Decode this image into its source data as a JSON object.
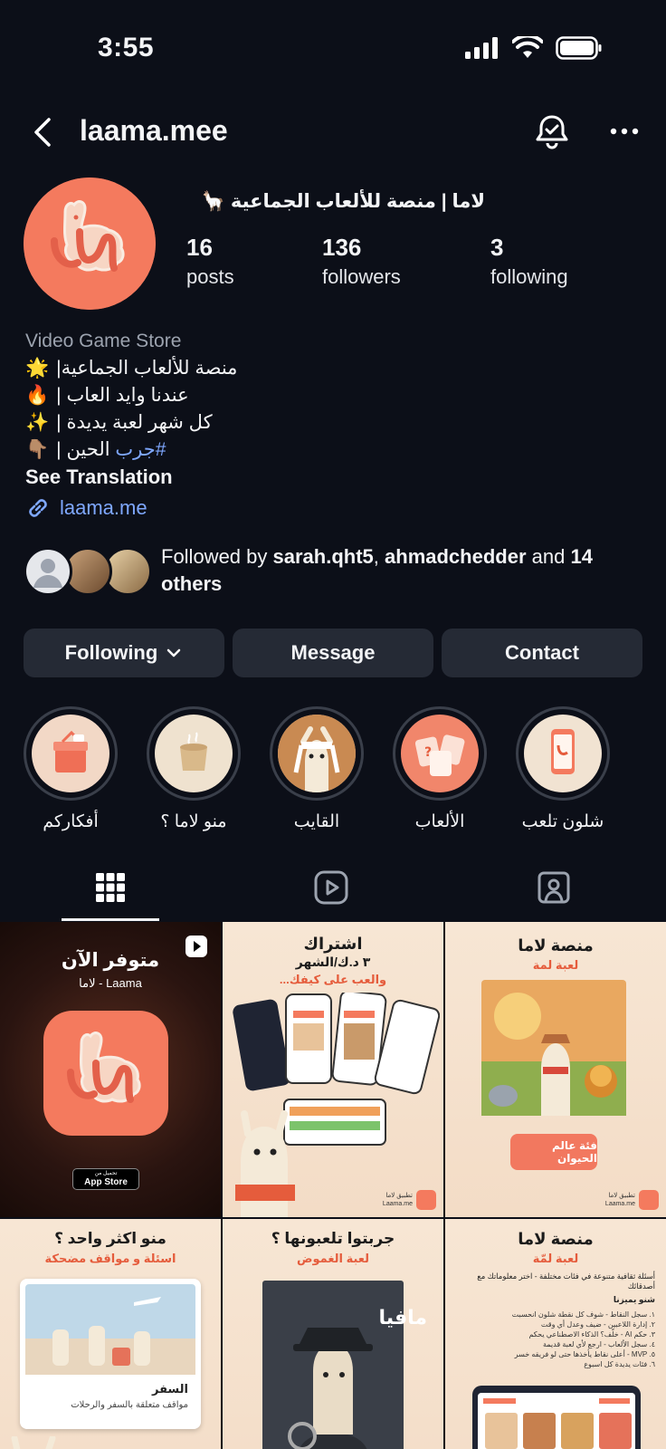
{
  "status_bar": {
    "time": "3:55"
  },
  "header": {
    "username": "laama.mee"
  },
  "profile": {
    "full_name": "لاما | منصة للألعاب الجماعية 🦙",
    "stats": [
      {
        "value": "16",
        "label": "posts"
      },
      {
        "value": "136",
        "label": "followers"
      },
      {
        "value": "3",
        "label": "following"
      }
    ],
    "category": "Video Game Store",
    "bio_lines": [
      {
        "emoji": "🌟",
        "text": "منصة للألعاب الجماعية|"
      },
      {
        "emoji": "🔥",
        "text": "عندنا وايد العاب |"
      },
      {
        "emoji": "✨",
        "text": "كل شهر لعبة يديدة |"
      },
      {
        "emoji": "👇🏽",
        "text": "الحين |",
        "hashtag": "#جرب"
      }
    ],
    "see_translation": "See Translation",
    "link": "laama.me"
  },
  "followed_by": {
    "prefix": "Followed by ",
    "user1": "sarah.qht5",
    "sep": ", ",
    "user2": "ahmadchedder",
    "mid": " and ",
    "rest": "14 others"
  },
  "actions": {
    "following": "Following",
    "message": "Message",
    "contact": "Contact"
  },
  "highlights": [
    {
      "label": "أفكاركم",
      "color": "#f2d8c6"
    },
    {
      "label": "منو لاما ؟",
      "color": "#efe2cf"
    },
    {
      "label": "القايب",
      "color": "#e9c7a3"
    },
    {
      "label": "الألعاب",
      "color": "#f1866b"
    },
    {
      "label": "شلون تلعب",
      "color": "#f1e3d2"
    }
  ],
  "posts": {
    "p1": {
      "title": "متوفر الآن",
      "sub": "Laama - لاما",
      "store_small": "تحميل من",
      "store": "App Store"
    },
    "p2": {
      "title": "اشتراك",
      "price": "٣ د.ك/الشهر",
      "sub": "والعب على كيفك...",
      "brand": "تطبيق لاما",
      "brand_url": "Laama.me"
    },
    "p3": {
      "title": "منصة لاما",
      "sub": "لعبة لمة",
      "button": "فئة عالم الحيوان",
      "brand": "تطبيق لاما",
      "brand_url": "Laama.me"
    },
    "p4": {
      "title": "منو اكثر واحد ؟",
      "sub": "اسئلة و مواقف مضحكة",
      "card_title": "السفر",
      "card_text": "مواقف متعلقة بالسفر والرحلات"
    },
    "p5": {
      "title": "جربتوا تلعبونها ؟",
      "sub": "لعبة الغموض",
      "tag": "مافيا"
    },
    "p6": {
      "title": "منصة لاما",
      "sub": "لعبة لمّة",
      "intro": "أسئلة ثقافية متنوعة في فئات مختلفة - اختر معلوماتك مع أصدقائك",
      "features_title": "شنو يميزنا",
      "features": [
        "١. سجل النقاط - شوف كل نقطة شلون انحسبت",
        "٢. إدارة اللاعبين - ضيف وعدل أي وقت",
        "٣. حكم AI - خلّف؟ الذكاء الاصطناعي يحكم",
        "٤. سجل الألعاب - ارجع لأي لعبة قديمة",
        "٥. MVP - أعلى نقاط يأخذها حتى لو فريقه خسر",
        "٦. فئات يديدة كل اسبوع"
      ]
    }
  }
}
